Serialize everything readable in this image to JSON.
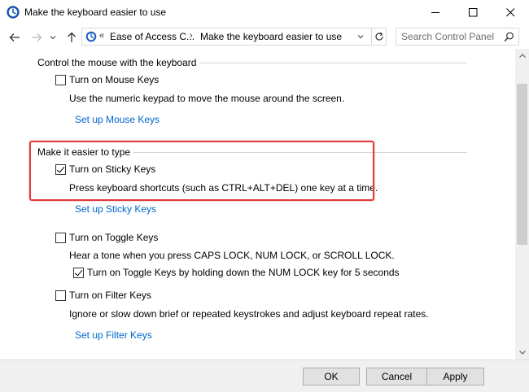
{
  "window": {
    "title": "Make the keyboard easier to use"
  },
  "address": {
    "prefix": "«",
    "crumbs": [
      "Ease of Access C...",
      "Make the keyboard easier to use"
    ],
    "separator": "›"
  },
  "search": {
    "placeholder": "Search Control Panel"
  },
  "sections": {
    "mouse": {
      "heading": "Control the mouse with the keyboard",
      "option_label": "Turn on Mouse Keys",
      "option_checked": false,
      "description": "Use the numeric keypad to move the mouse around the screen.",
      "link": "Set up Mouse Keys"
    },
    "typing": {
      "heading": "Make it easier to type",
      "sticky_label": "Turn on Sticky Keys",
      "sticky_checked": true,
      "sticky_description": "Press keyboard shortcuts (such as CTRL+ALT+DEL) one key at a time.",
      "sticky_link": "Set up Sticky Keys",
      "toggle_label": "Turn on Toggle Keys",
      "toggle_checked": false,
      "toggle_description": "Hear a tone when you press CAPS LOCK, NUM LOCK, or SCROLL LOCK.",
      "toggle_sub_label": "Turn on Toggle Keys by holding down the NUM LOCK key for 5 seconds",
      "toggle_sub_checked": true,
      "filter_label": "Turn on Filter Keys",
      "filter_checked": false,
      "filter_description": "Ignore or slow down brief or repeated keystrokes and adjust keyboard repeat rates.",
      "filter_link": "Set up Filter Keys"
    }
  },
  "footer": {
    "ok": "OK",
    "cancel": "Cancel",
    "apply": "Apply"
  },
  "colors": {
    "link": "#0066cc",
    "highlight": "#e03a3a",
    "footer_bg": "#f0f0f0"
  }
}
